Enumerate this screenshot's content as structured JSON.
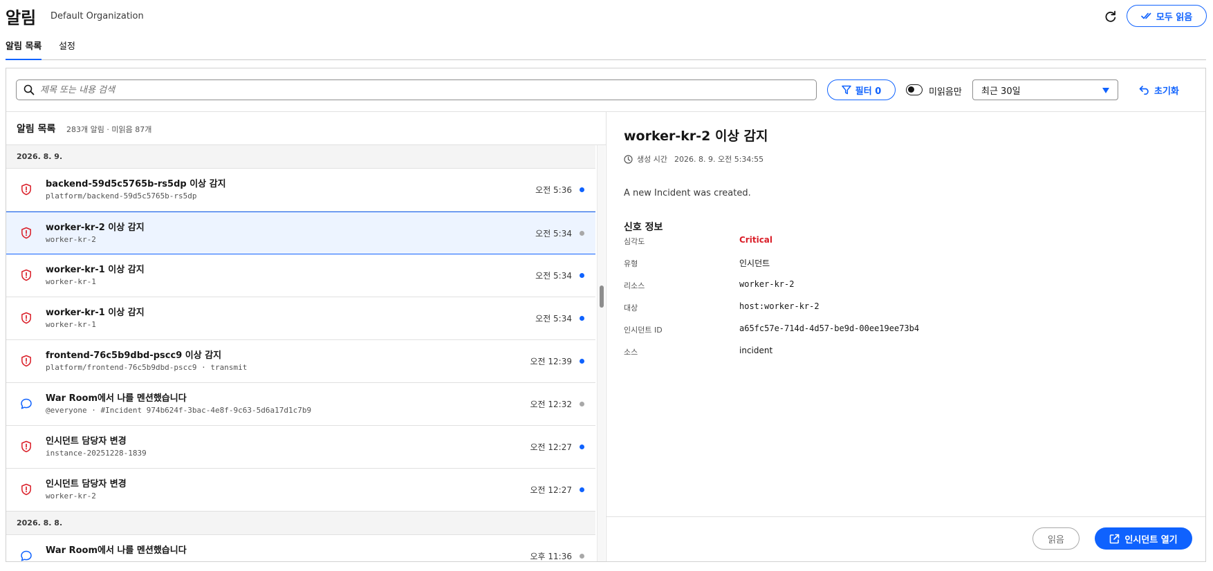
{
  "header": {
    "title": "알림",
    "organization": "Default Organization",
    "refresh_icon": "refresh-icon",
    "read_all_label": "모두 읽음"
  },
  "tabs": [
    {
      "label": "알림 목록",
      "active": true
    },
    {
      "label": "설정",
      "active": false
    }
  ],
  "toolbar": {
    "search_placeholder": "제목 또는 내용 검색",
    "search_value": "",
    "filter_label": "필터 0",
    "unread_only_label": "미읽음만",
    "unread_only": false,
    "range_value": "최근 30일",
    "reset_label": "초기화"
  },
  "list": {
    "title": "알림 목록",
    "count_text": "283개 알림 · 미읽음 87개",
    "groups": [
      {
        "date": "2026. 8. 9.",
        "items": [
          {
            "icon": "shield-alert-icon",
            "title": "backend-59d5c5765b-rs5dp 이상 감지",
            "subtitle": "platform/backend-59d5c5765b-rs5dp",
            "time": "오전 5:36",
            "unread": true,
            "selected": false
          },
          {
            "icon": "shield-alert-icon",
            "title": "worker-kr-2 이상 감지",
            "subtitle": "worker-kr-2",
            "time": "오전 5:34",
            "unread": false,
            "selected": true
          },
          {
            "icon": "shield-alert-icon",
            "title": "worker-kr-1 이상 감지",
            "subtitle": "worker-kr-1",
            "time": "오전 5:34",
            "unread": true,
            "selected": false
          },
          {
            "icon": "shield-alert-icon",
            "title": "worker-kr-1 이상 감지",
            "subtitle": "worker-kr-1",
            "time": "오전 5:34",
            "unread": true,
            "selected": false
          },
          {
            "icon": "shield-alert-icon",
            "title": "frontend-76c5b9dbd-pscc9 이상 감지",
            "subtitle": "platform/frontend-76c5b9dbd-pscc9 · transmit",
            "time": "오전 12:39",
            "unread": true,
            "selected": false
          },
          {
            "icon": "chat-bubble-icon",
            "title": "War Room에서 나를 멘션했습니다",
            "subtitle": "@everyone · #Incident 974b624f-3bac-4e8f-9c63-5d6a17d1c7b9",
            "time": "오전 12:32",
            "unread": false,
            "selected": false
          },
          {
            "icon": "shield-alert-icon",
            "title": "인시던트 담당자 변경",
            "subtitle": "instance-20251228-1839",
            "time": "오전 12:27",
            "unread": true,
            "selected": false
          },
          {
            "icon": "shield-alert-icon",
            "title": "인시던트 담당자 변경",
            "subtitle": "worker-kr-2",
            "time": "오전 12:27",
            "unread": true,
            "selected": false
          }
        ]
      },
      {
        "date": "2026. 8. 8.",
        "items": [
          {
            "icon": "chat-bubble-icon",
            "title": "War Room에서 나를 멘션했습니다",
            "subtitle": "",
            "time": "오후 11:36",
            "unread": false,
            "selected": false
          }
        ]
      }
    ]
  },
  "detail": {
    "title": "worker-kr-2 이상 감지",
    "created_label": "생성 시간",
    "created_value": "2026. 8. 9. 오전 5:34:55",
    "message": "A new Incident was created.",
    "signal_title": "신호 정보",
    "fields": [
      {
        "label": "심각도",
        "value": "Critical",
        "mono": false,
        "critical": true
      },
      {
        "label": "유형",
        "value": "인시던트",
        "mono": false,
        "critical": false
      },
      {
        "label": "리소스",
        "value": "worker-kr-2",
        "mono": true,
        "critical": false
      },
      {
        "label": "대상",
        "value": "host:worker-kr-2",
        "mono": true,
        "critical": false
      },
      {
        "label": "인시던트 ID",
        "value": "a65fc57e-714d-4d57-be9d-00ee19ee73b4",
        "mono": true,
        "critical": false
      },
      {
        "label": "소스",
        "value": "incident",
        "mono": false,
        "critical": false
      }
    ],
    "read_label": "읽음",
    "open_incident_label": "인시던트 열기"
  },
  "colors": {
    "accent": "#0f62fe",
    "critical": "#da1e28",
    "unread_dot": "#0f62fe",
    "read_dot": "#a8a8a8",
    "selected_row_bg": "#edf4ff"
  }
}
